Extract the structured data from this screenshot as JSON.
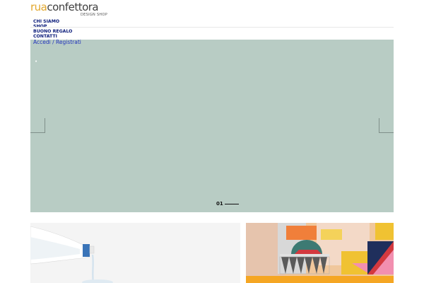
{
  "brand": {
    "logo_prefix": "rua",
    "logo_suffix": "confettora",
    "tagline": "DESIGN SHOP"
  },
  "nav": {
    "items": [
      {
        "label": "CHI SIAMO"
      },
      {
        "label": "SHOP"
      },
      {
        "label": "BUONO REGALO"
      },
      {
        "label": "CONTATTI"
      }
    ],
    "account_label": "Accedi / Registrati"
  },
  "hero": {
    "background": "#b8ccc4",
    "dot": "•",
    "slide_number": "01",
    "prev_icon": "chevron-left-icon",
    "next_icon": "chevron-right-icon"
  },
  "cards": [
    {
      "image": "water-bottle-pouring"
    },
    {
      "image": "colorful-geometric-shapes"
    }
  ]
}
